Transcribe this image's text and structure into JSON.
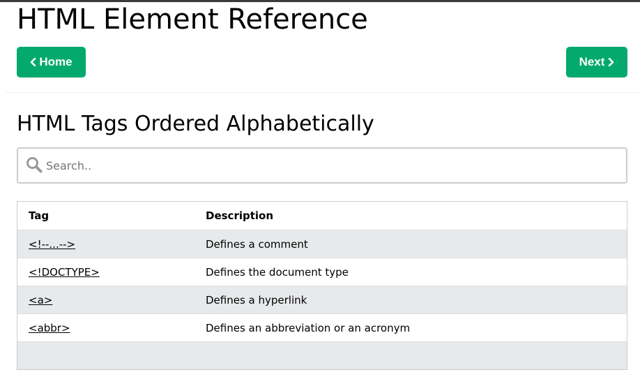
{
  "page": {
    "title": "HTML Element Reference"
  },
  "nav": {
    "home_label": "Home",
    "next_label": "Next",
    "accent_color": "#04AA6D"
  },
  "section": {
    "title": "HTML Tags Ordered Alphabetically"
  },
  "search": {
    "placeholder": "Search..",
    "value": "",
    "icon": "search-icon"
  },
  "table": {
    "headers": [
      "Tag",
      "Description"
    ],
    "rows": [
      {
        "tag": "<!--...-->",
        "description": "Defines a comment"
      },
      {
        "tag": "<!DOCTYPE>",
        "description": "Defines the document type"
      },
      {
        "tag": "<a>",
        "description": "Defines a hyperlink"
      },
      {
        "tag": "<abbr>",
        "description": "Defines an abbreviation or an acronym"
      }
    ]
  }
}
